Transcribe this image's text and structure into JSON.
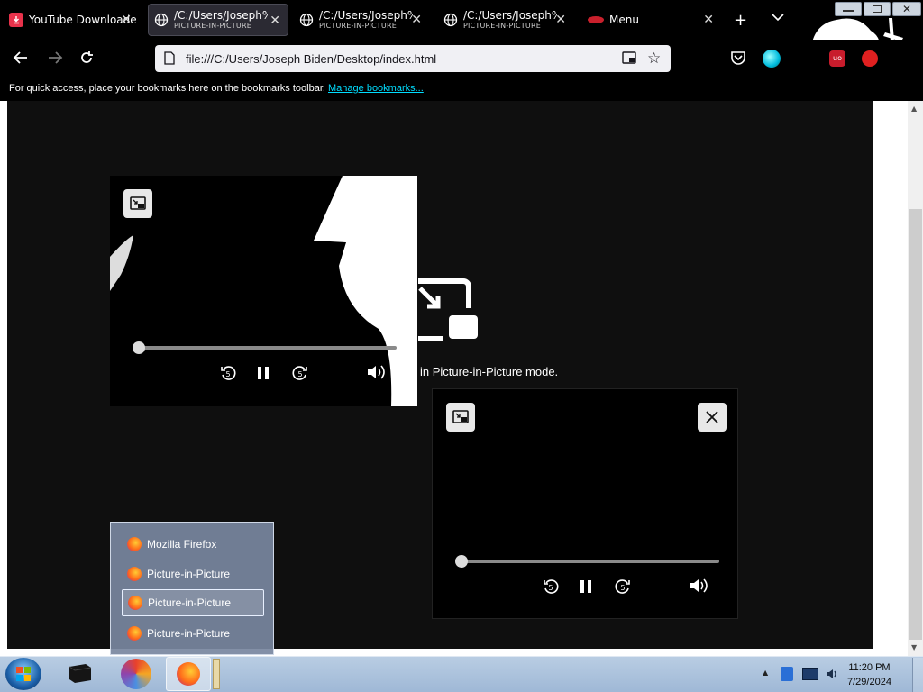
{
  "tabs": [
    {
      "title": "YouTube Downloade",
      "subtitle": ""
    },
    {
      "title": "/C:/Users/Joseph%...",
      "subtitle": "PICTURE-IN-PICTURE"
    },
    {
      "title": "/C:/Users/Joseph%...",
      "subtitle": "PICTURE-IN-PICTURE"
    },
    {
      "title": "/C:/Users/Joseph%...",
      "subtitle": "PICTURE-IN-PICTURE"
    },
    {
      "title": "Menu",
      "subtitle": ""
    }
  ],
  "address": {
    "url": "file:///C:/Users/Joseph Biden/Desktop/index.html"
  },
  "bookmarks": {
    "text": "For quick access, place your bookmarks here on the bookmarks toolbar.",
    "link": "Manage bookmarks..."
  },
  "page": {
    "message_fragment": "in Picture-in-Picture mode."
  },
  "pip_windows": [
    {
      "progress": 0.0
    },
    {
      "progress": 0.0
    }
  ],
  "jumplist": {
    "items": [
      "Mozilla Firefox",
      "Picture-in-Picture",
      "Picture-in-Picture",
      "Picture-in-Picture"
    ],
    "selected_index": 2
  },
  "clock": {
    "time": "11:20 PM",
    "date": "7/29/2024"
  },
  "colors": {
    "accent_link": "#00ddff",
    "page_bg": "#0f0f0f",
    "taskbar": "#a9c0dc"
  }
}
